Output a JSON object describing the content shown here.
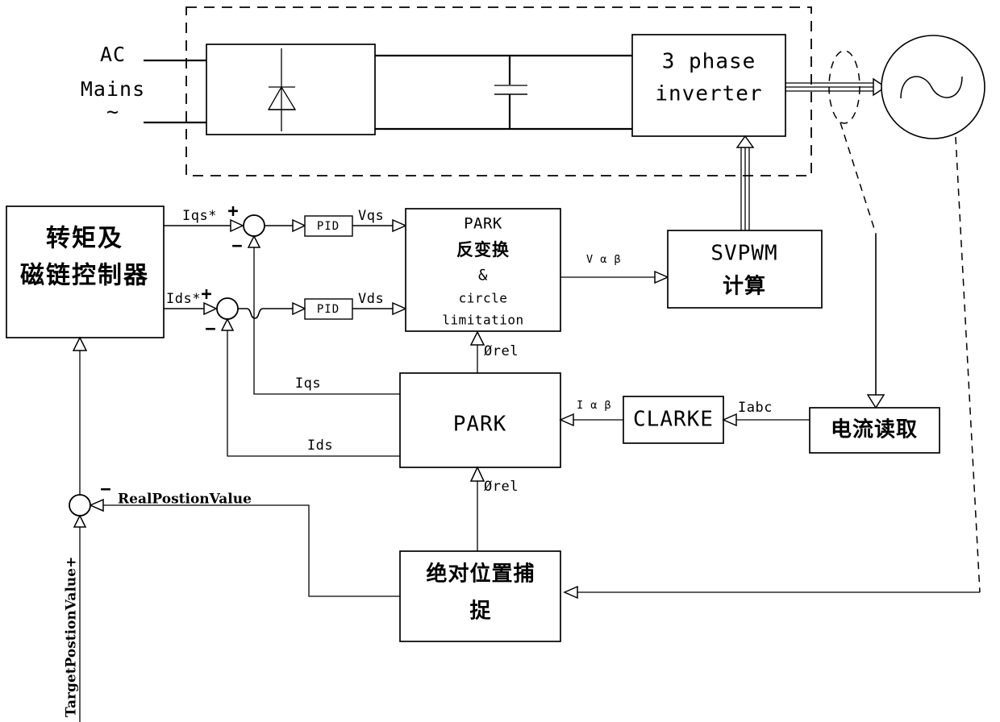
{
  "diagram": {
    "title": "Field Oriented Control (FOC) motor drive block diagram",
    "power_stage": {
      "source_label_line1": "AC",
      "source_label_line2": "Mains",
      "source_label_line3": "~",
      "rectifier_symbol": "diode",
      "dc_link_symbol": "capacitor",
      "inverter_line1": "3 phase",
      "inverter_line2": "inverter",
      "motor_symbol": "sine"
    },
    "blocks": {
      "torque_flux_controller_line1": "转矩及",
      "torque_flux_controller_line2": "磁链控制器",
      "pid_qs": "PID",
      "pid_ds": "PID",
      "park_inverse_line1": "PARK",
      "park_inverse_line2": "反变换",
      "park_inverse_line3": "&",
      "park_inverse_line4": "circle",
      "park_inverse_line5": "limitation",
      "svpwm_line1": "SVPWM",
      "svpwm_line2": "计算",
      "park": "PARK",
      "clarke": "CLARKE",
      "current_read": "电流读取",
      "position_capture_line1": "绝对位置捕",
      "position_capture_line2": "捉"
    },
    "signals": {
      "iqs_ref": "Iqs*",
      "ids_ref": "Ids*",
      "vqs": "Vqs",
      "vds": "Vds",
      "v_alpha_beta": "V α β",
      "i_alpha_beta": "I α β",
      "iabc": "Iabc",
      "iqs": "Iqs",
      "ids": "Ids",
      "theta_rel_upper": "Ørel",
      "theta_rel_lower": "Ørel",
      "real_position": "RealPostionValue",
      "target_position": "TargetPostionValue+",
      "plus_sign_iqs": "+",
      "minus_sign_iqs": "−",
      "plus_sign_ids": "+",
      "minus_sign_ids": "−",
      "minus_sign_position": "−"
    },
    "colors": {
      "stroke": "#000000",
      "background": "#ffffff"
    }
  }
}
